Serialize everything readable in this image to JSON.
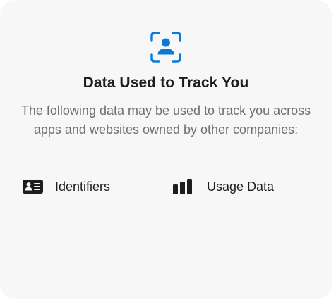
{
  "header": {
    "icon": "tracking-person-icon",
    "title": "Data Used to Track You",
    "description": "The following data may be used to track you across apps and websites owned by other companies:"
  },
  "items": [
    {
      "icon": "id-card-icon",
      "label": "Identifiers"
    },
    {
      "icon": "bar-chart-icon",
      "label": "Usage Data"
    }
  ],
  "colors": {
    "accent": "#0a7ad6",
    "card_background": "#f7f7f7",
    "title": "#1d1d1f",
    "description": "#6e6e73"
  }
}
